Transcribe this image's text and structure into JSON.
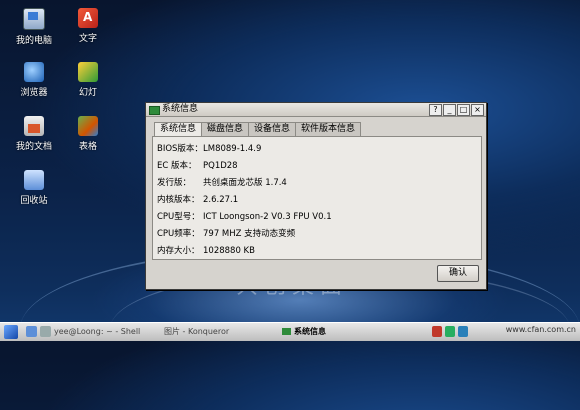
{
  "desktop": {
    "icons": [
      {
        "label": "我的电脑",
        "icon": "computer-icon"
      },
      {
        "label": "文字",
        "icon": "text-doc-icon"
      },
      {
        "label": "浏览器",
        "icon": "browser-icon"
      },
      {
        "label": "幻灯",
        "icon": "slides-icon"
      },
      {
        "label": "我的文档",
        "icon": "documents-icon"
      },
      {
        "label": "表格",
        "icon": "spreadsheet-icon"
      },
      {
        "label": "回收站",
        "icon": "trash-icon"
      }
    ]
  },
  "window": {
    "title": "系统信息",
    "controls": [
      "?",
      "_",
      "□",
      "×"
    ],
    "tabs": [
      "系统信息",
      "磁盘信息",
      "设备信息",
      "软件版本信息"
    ],
    "active_tab": 0,
    "rows": [
      {
        "key": "BIOS版本：",
        "value": "LM8089-1.4.9"
      },
      {
        "key": "EC 版本：",
        "value": "PQ1D28"
      },
      {
        "key": "发行版：",
        "value": "共创桌面龙芯版 1.7.4"
      },
      {
        "key": "内核版本：",
        "value": "2.6.27.1"
      },
      {
        "key": "CPU型号：",
        "value": "ICT Loongson-2 V0.3  FPU V0.1"
      },
      {
        "key": "CPU频率：",
        "value": "797 MHZ   支持动态变频"
      },
      {
        "key": "内存大小：",
        "value": "1028880 KB"
      }
    ],
    "ok_label": "确认"
  },
  "taskbar": {
    "items": [
      {
        "label": "yee@Loong: ~ - Shell"
      },
      {
        "label": "图片 - Konqueror"
      },
      {
        "label": "系统信息"
      }
    ],
    "watermark": "www.cfan.com.cn"
  }
}
